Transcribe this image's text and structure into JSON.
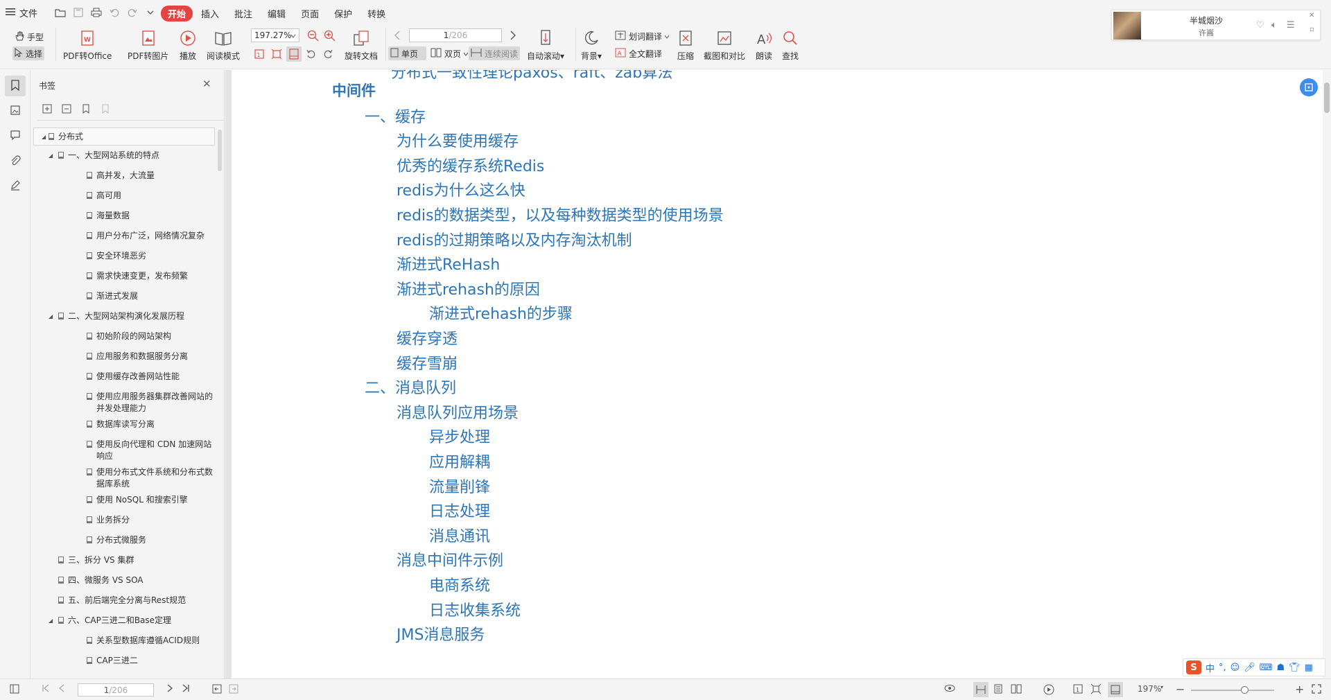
{
  "menubar": {
    "file_label": "文件",
    "tabs": [
      {
        "label": "开始",
        "active": true
      },
      {
        "label": "插入"
      },
      {
        "label": "批注"
      },
      {
        "label": "编辑"
      },
      {
        "label": "页面"
      },
      {
        "label": "保护"
      },
      {
        "label": "转换"
      }
    ]
  },
  "ribbon": {
    "hand_tool": "手型",
    "select_tool": "选择",
    "pdf_to_office": "PDF转Office",
    "pdf_to_image": "PDF转图片",
    "play": "播放",
    "read_mode": "阅读模式",
    "zoom_value": "197.27%",
    "rotate_doc": "旋转文档",
    "page_current": "1",
    "page_total": "/206",
    "single_page": "单页",
    "double_page": "双页",
    "continuous_read": "连续阅读",
    "auto_scroll": "自动滚动",
    "background": "背景",
    "word_translate": "划词翻译",
    "full_translate": "全文翻译",
    "compress": "压缩",
    "screenshot_compare": "截图和对比",
    "read_aloud": "朗读",
    "find": "查找"
  },
  "music": {
    "song": "半城烟沙",
    "artist": "许嵩"
  },
  "bookmarks": {
    "title": "书签",
    "items": [
      {
        "label": "分布式",
        "level": 0,
        "expanded": true
      },
      {
        "label": "一、大型网站系统的特点",
        "level": 1,
        "expanded": true
      },
      {
        "label": "高并发，大流量",
        "level": 2
      },
      {
        "label": "高可用",
        "level": 2
      },
      {
        "label": "海量数据",
        "level": 2
      },
      {
        "label": "用户分布广泛，网络情况复杂",
        "level": 2
      },
      {
        "label": "安全环境恶劣",
        "level": 2
      },
      {
        "label": "需求快速变更，发布频繁",
        "level": 2
      },
      {
        "label": "渐进式发展",
        "level": 2
      },
      {
        "label": "二、大型网站架构演化发展历程",
        "level": 1,
        "expanded": true
      },
      {
        "label": "初始阶段的网站架构",
        "level": 2
      },
      {
        "label": "应用服务和数据服务分离",
        "level": 2
      },
      {
        "label": "使用缓存改善网站性能",
        "level": 2
      },
      {
        "label": "使用应用服务器集群改善网站的并发处理能力",
        "level": 2
      },
      {
        "label": "数据库读写分离",
        "level": 2
      },
      {
        "label": "使用反向代理和 CDN 加速网站响应",
        "level": 2
      },
      {
        "label": "使用分布式文件系统和分布式数据库系统",
        "level": 2
      },
      {
        "label": "使用 NoSQL 和搜索引擎",
        "level": 2
      },
      {
        "label": "业务拆分",
        "level": 2
      },
      {
        "label": "分布式微服务",
        "level": 2
      },
      {
        "label": "三、拆分 VS 集群",
        "level": 1
      },
      {
        "label": "四、微服务 VS SOA",
        "level": 1
      },
      {
        "label": "五、前后端完全分离与Rest规范",
        "level": 1
      },
      {
        "label": "六、CAP三进二和Base定理",
        "level": 1,
        "expanded": true
      },
      {
        "label": "关系型数据库遵循ACID规则",
        "level": 2
      },
      {
        "label": "CAP三进二",
        "level": 2
      }
    ]
  },
  "document": {
    "partial_line": "分布式一致性理论paxos、raft、zab算法",
    "entries": [
      {
        "text": "中间件",
        "cls": "h1"
      },
      {
        "text": "一、缓存",
        "cls": "h2"
      },
      {
        "text": "为什么要使用缓存",
        "cls": "h3"
      },
      {
        "text": "优秀的缓存系统Redis",
        "cls": "h3"
      },
      {
        "text": "redis为什么这么快",
        "cls": "h3"
      },
      {
        "text": "redis的数据类型，以及每种数据类型的使用场景",
        "cls": "h3"
      },
      {
        "text": "redis的过期策略以及内存淘汰机制",
        "cls": "h3"
      },
      {
        "text": "渐进式ReHash",
        "cls": "h3"
      },
      {
        "text": "渐进式rehash的原因",
        "cls": "h3"
      },
      {
        "text": "渐进式rehash的步骤",
        "cls": "h4"
      },
      {
        "text": "缓存穿透",
        "cls": "h3"
      },
      {
        "text": "缓存雪崩",
        "cls": "h3"
      },
      {
        "text": "二、消息队列",
        "cls": "h2"
      },
      {
        "text": "消息队列应用场景",
        "cls": "h3"
      },
      {
        "text": "异步处理",
        "cls": "h4"
      },
      {
        "text": "应用解耦",
        "cls": "h4"
      },
      {
        "text": "流量削锋",
        "cls": "h4"
      },
      {
        "text": "日志处理",
        "cls": "h4"
      },
      {
        "text": "消息通讯",
        "cls": "h4"
      },
      {
        "text": "消息中间件示例",
        "cls": "h3"
      },
      {
        "text": "电商系统",
        "cls": "h4"
      },
      {
        "text": "日志收集系统",
        "cls": "h4"
      },
      {
        "text": "JMS消息服务",
        "cls": "h3"
      }
    ]
  },
  "ime": {
    "logo": "S",
    "lang": "中"
  },
  "statusbar": {
    "page_current": "1",
    "page_total": "/206",
    "zoom": "197%"
  },
  "colors": {
    "link_blue": "#2e75b6",
    "accent_red": "#e44444"
  }
}
